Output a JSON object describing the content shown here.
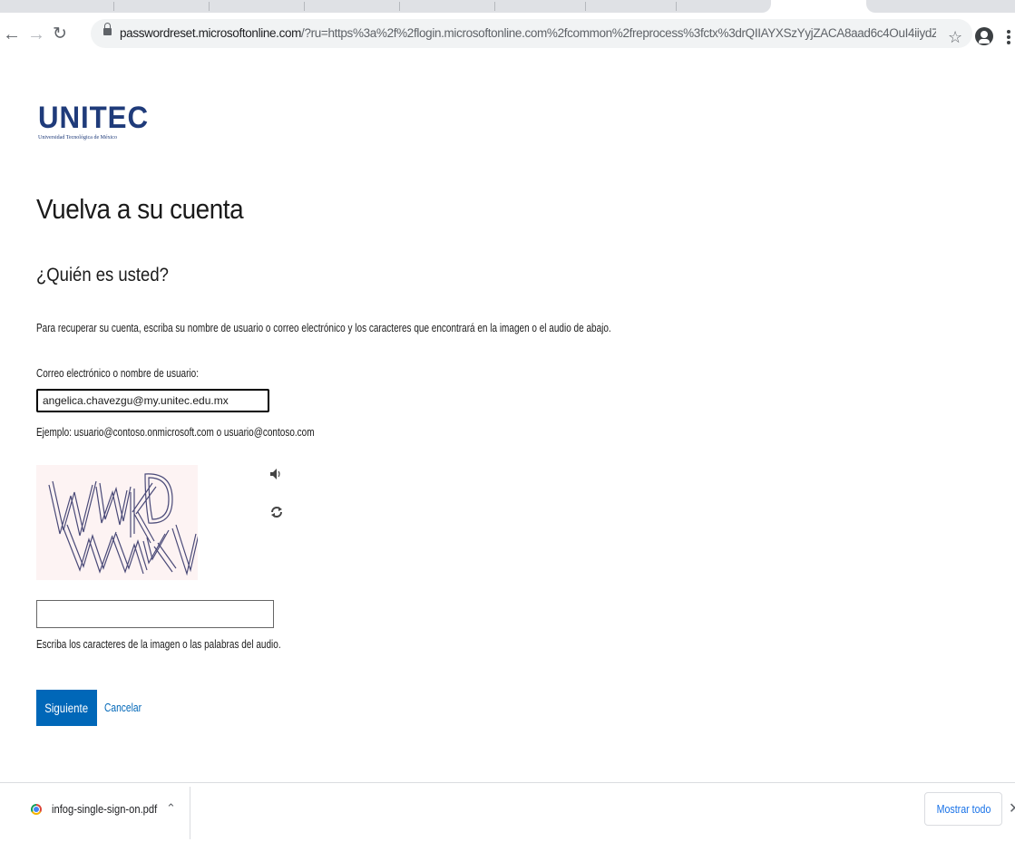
{
  "browser": {
    "url_host": "passwordreset.microsoftonline.com",
    "url_path": "/?ru=https%3a%2f%2flogin.microsoftonline.com%2fcommon%2freprocess%3fctx%3drQIIAYXSzYyjZACA8aad6c4OuI4iiydZUFwR2r75bgb3kDR...",
    "back_icon": "back-arrow-icon",
    "forward_icon": "forward-arrow-icon",
    "reload_icon": "reload-icon",
    "bookmark_icon": "star-icon",
    "profile_icon": "profile-icon",
    "menu_icon": "kebab-menu-icon"
  },
  "logo": {
    "text": "UNITEC",
    "subtitle": "Universidad Tecnológica de México",
    "color": "#1f3b7a"
  },
  "page": {
    "title": "Vuelva a su cuenta",
    "section_title": "¿Quién es usted?",
    "instructions": "Para recuperar su cuenta, escriba su nombre de usuario o correo electrónico y los caracteres que encontrará en la imagen o el audio de abajo.",
    "email_label": "Correo electrónico o nombre de usuario:",
    "email_value": "angelica.chavezgu@my.unitec.edu.mx",
    "example": "Ejemplo: usuario@contoso.onmicrosoft.com o usuario@contoso.com",
    "captcha_value": "",
    "captcha_help": "Escriba los caracteres de la imagen o las palabras del audio.",
    "next_button": "Siguiente",
    "cancel_link": "Cancelar",
    "accent_color": "#0067b8"
  },
  "downloads": {
    "file_name": "infog-single-sign-on.pdf",
    "show_all": "Mostrar todo",
    "close": "✕"
  }
}
